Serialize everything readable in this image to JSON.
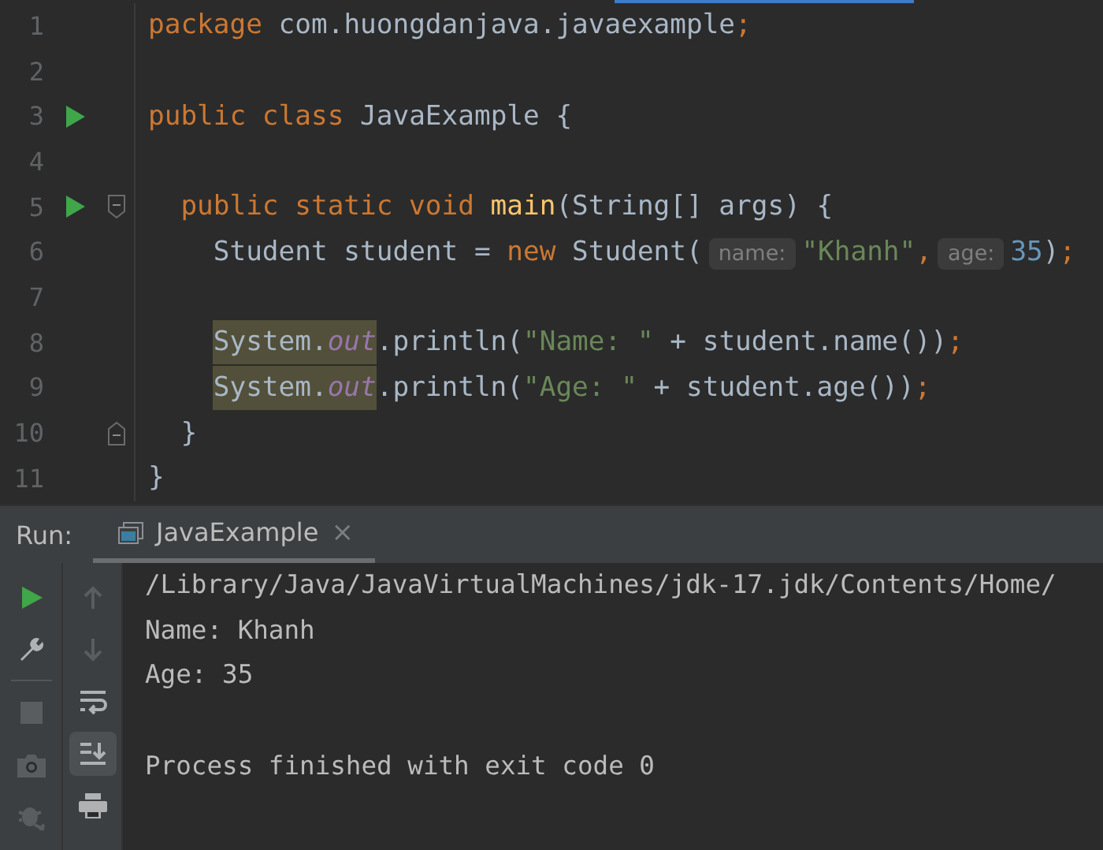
{
  "editor": {
    "lines": [
      {
        "number": "1",
        "run": false,
        "fold_open": false,
        "fold_close": false,
        "tokens": [
          {
            "kind": "keyword",
            "text": "package "
          },
          {
            "kind": "plain",
            "text": "com.huongdanjava.javaexample"
          },
          {
            "kind": "punct",
            "text": ";"
          }
        ]
      },
      {
        "number": "2",
        "run": false,
        "fold_open": false,
        "fold_close": false
      },
      {
        "number": "3",
        "run": true,
        "fold_open": false,
        "fold_close": false,
        "tokens": [
          {
            "kind": "keyword",
            "text": "public class "
          },
          {
            "kind": "plain",
            "text": "JavaExample {"
          }
        ],
        "children": [
          {
            "number": "4",
            "run": false,
            "fold_open": false,
            "fold_close": false
          },
          {
            "number": "5",
            "run": true,
            "fold_open": true,
            "fold_close": false,
            "tokens": [
              {
                "kind": "keyword",
                "text": "public static void "
              },
              {
                "kind": "method",
                "text": "main"
              },
              {
                "kind": "plain",
                "text": "(String[] args) {"
              }
            ],
            "children": [
              {
                "number": "6",
                "run": false,
                "fold_open": false,
                "fold_close": false,
                "tokens": [
                  {
                    "kind": "plain",
                    "text": "Student student = "
                  },
                  {
                    "kind": "keyword",
                    "text": "new"
                  },
                  {
                    "kind": "plain",
                    "text": " Student("
                  },
                  {
                    "kind": "hint",
                    "text": "name:"
                  },
                  {
                    "kind": "string",
                    "text": "\"Khanh\""
                  },
                  {
                    "kind": "punct",
                    "text": ","
                  },
                  {
                    "kind": "hint",
                    "text": "age:"
                  },
                  {
                    "kind": "number",
                    "text": "35"
                  },
                  {
                    "kind": "plain",
                    "text": ")"
                  },
                  {
                    "kind": "punct",
                    "text": ";"
                  }
                ]
              },
              {
                "number": "7",
                "run": false,
                "fold_open": false,
                "fold_close": false
              },
              {
                "number": "8",
                "run": false,
                "fold_open": false,
                "fold_close": false,
                "tokens": [
                  {
                    "kind": "usage",
                    "parts": [
                      {
                        "kind": "plain",
                        "text": "System."
                      },
                      {
                        "kind": "field",
                        "text": "out"
                      }
                    ]
                  },
                  {
                    "kind": "plain",
                    "text": ".println("
                  },
                  {
                    "kind": "string",
                    "text": "\"Name: \""
                  },
                  {
                    "kind": "plain",
                    "text": " + student.name())"
                  },
                  {
                    "kind": "punct",
                    "text": ";"
                  }
                ]
              },
              {
                "number": "9",
                "run": false,
                "fold_open": false,
                "fold_close": false,
                "tokens": [
                  {
                    "kind": "usage",
                    "parts": [
                      {
                        "kind": "plain",
                        "text": "System."
                      },
                      {
                        "kind": "field",
                        "text": "out"
                      }
                    ]
                  },
                  {
                    "kind": "plain",
                    "text": ".println("
                  },
                  {
                    "kind": "string",
                    "text": "\"Age: \""
                  },
                  {
                    "kind": "plain",
                    "text": " + student.age())"
                  },
                  {
                    "kind": "punct",
                    "text": ";"
                  }
                ]
              }
            ]
          },
          {
            "number": "10",
            "run": false,
            "fold_open": false,
            "fold_close": true,
            "tokens": [
              {
                "kind": "plain",
                "text": "}"
              }
            ]
          }
        ]
      },
      {
        "number": "11",
        "run": false,
        "fold_open": false,
        "fold_close": false,
        "tokens": [
          {
            "kind": "plain",
            "text": "}"
          }
        ]
      }
    ]
  },
  "run_panel": {
    "label": "Run:",
    "tab": {
      "title": "JavaExample",
      "selected": true,
      "close": "×"
    }
  },
  "left_tools": [
    {
      "disabled": false
    },
    {
      "disabled": false
    },
    {
      "disabled": true
    },
    {
      "disabled": true
    },
    {
      "disabled": true
    }
  ],
  "right_tools": [
    {
      "disabled": true,
      "selected": false
    },
    {
      "disabled": true,
      "selected": false
    },
    {
      "disabled": false,
      "selected": false
    },
    {
      "disabled": false,
      "selected": true
    },
    {
      "disabled": false,
      "selected": false
    }
  ],
  "console": {
    "command": "/Library/Java/JavaVirtualMachines/jdk-17.jdk/Contents/Home/",
    "output": [
      "Name: Khanh",
      "Age: 35"
    ],
    "exit_message": "Process finished with exit code 0"
  }
}
